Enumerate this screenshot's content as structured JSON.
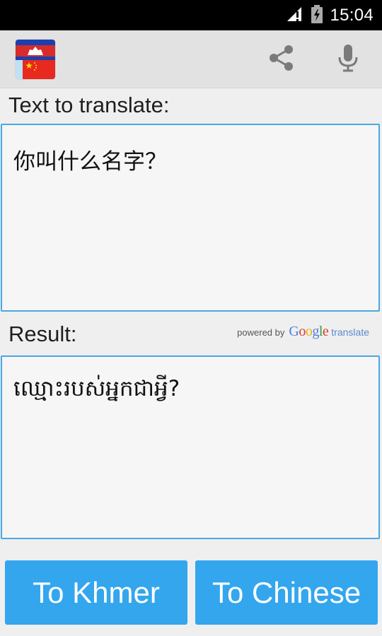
{
  "status_bar": {
    "time": "15:04"
  },
  "action_bar": {
    "icons": [
      "app-flag-icon",
      "share-icon",
      "microphone-icon"
    ]
  },
  "input_section": {
    "label": "Text to translate:",
    "value": "你叫什么名字？"
  },
  "result_section": {
    "label": "Result:",
    "value": "ឈ្មោះរបស់អ្នកជាអ្វី?",
    "attribution": {
      "powered_by": "powered by",
      "google": [
        "G",
        "o",
        "o",
        "g",
        "l",
        "e"
      ],
      "translate": "translate"
    }
  },
  "buttons": {
    "to_khmer": "To Khmer",
    "to_chinese": "To Chinese"
  },
  "colors": {
    "accent": "#33a6ee",
    "border": "#4ba7e3",
    "google_blue": "#4a7fe0",
    "google_red": "#db3a2f",
    "google_yellow": "#e7b20c",
    "google_green": "#2e9e46"
  }
}
